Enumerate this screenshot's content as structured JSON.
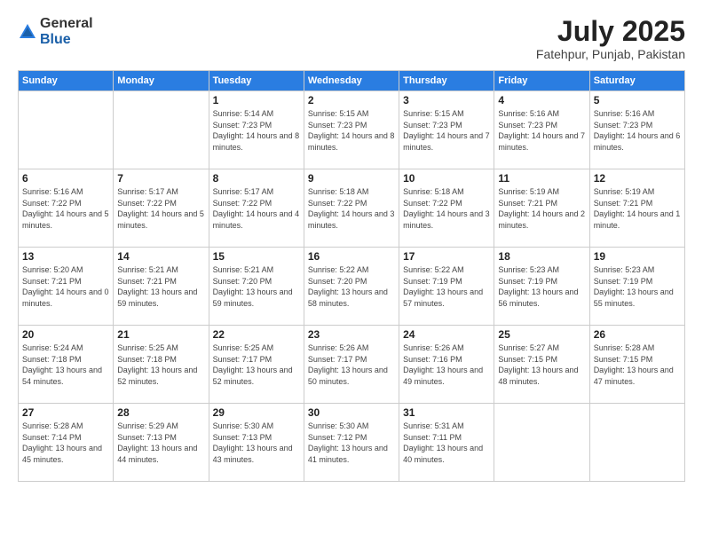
{
  "header": {
    "logo_general": "General",
    "logo_blue": "Blue",
    "month": "July 2025",
    "location": "Fatehpur, Punjab, Pakistan"
  },
  "days_of_week": [
    "Sunday",
    "Monday",
    "Tuesday",
    "Wednesday",
    "Thursday",
    "Friday",
    "Saturday"
  ],
  "weeks": [
    [
      {
        "num": "",
        "info": ""
      },
      {
        "num": "",
        "info": ""
      },
      {
        "num": "1",
        "info": "Sunrise: 5:14 AM\nSunset: 7:23 PM\nDaylight: 14 hours\nand 8 minutes."
      },
      {
        "num": "2",
        "info": "Sunrise: 5:15 AM\nSunset: 7:23 PM\nDaylight: 14 hours\nand 8 minutes."
      },
      {
        "num": "3",
        "info": "Sunrise: 5:15 AM\nSunset: 7:23 PM\nDaylight: 14 hours\nand 7 minutes."
      },
      {
        "num": "4",
        "info": "Sunrise: 5:16 AM\nSunset: 7:23 PM\nDaylight: 14 hours\nand 7 minutes."
      },
      {
        "num": "5",
        "info": "Sunrise: 5:16 AM\nSunset: 7:23 PM\nDaylight: 14 hours\nand 6 minutes."
      }
    ],
    [
      {
        "num": "6",
        "info": "Sunrise: 5:16 AM\nSunset: 7:22 PM\nDaylight: 14 hours\nand 5 minutes."
      },
      {
        "num": "7",
        "info": "Sunrise: 5:17 AM\nSunset: 7:22 PM\nDaylight: 14 hours\nand 5 minutes."
      },
      {
        "num": "8",
        "info": "Sunrise: 5:17 AM\nSunset: 7:22 PM\nDaylight: 14 hours\nand 4 minutes."
      },
      {
        "num": "9",
        "info": "Sunrise: 5:18 AM\nSunset: 7:22 PM\nDaylight: 14 hours\nand 3 minutes."
      },
      {
        "num": "10",
        "info": "Sunrise: 5:18 AM\nSunset: 7:22 PM\nDaylight: 14 hours\nand 3 minutes."
      },
      {
        "num": "11",
        "info": "Sunrise: 5:19 AM\nSunset: 7:21 PM\nDaylight: 14 hours\nand 2 minutes."
      },
      {
        "num": "12",
        "info": "Sunrise: 5:19 AM\nSunset: 7:21 PM\nDaylight: 14 hours\nand 1 minute."
      }
    ],
    [
      {
        "num": "13",
        "info": "Sunrise: 5:20 AM\nSunset: 7:21 PM\nDaylight: 14 hours\nand 0 minutes."
      },
      {
        "num": "14",
        "info": "Sunrise: 5:21 AM\nSunset: 7:21 PM\nDaylight: 13 hours\nand 59 minutes."
      },
      {
        "num": "15",
        "info": "Sunrise: 5:21 AM\nSunset: 7:20 PM\nDaylight: 13 hours\nand 59 minutes."
      },
      {
        "num": "16",
        "info": "Sunrise: 5:22 AM\nSunset: 7:20 PM\nDaylight: 13 hours\nand 58 minutes."
      },
      {
        "num": "17",
        "info": "Sunrise: 5:22 AM\nSunset: 7:19 PM\nDaylight: 13 hours\nand 57 minutes."
      },
      {
        "num": "18",
        "info": "Sunrise: 5:23 AM\nSunset: 7:19 PM\nDaylight: 13 hours\nand 56 minutes."
      },
      {
        "num": "19",
        "info": "Sunrise: 5:23 AM\nSunset: 7:19 PM\nDaylight: 13 hours\nand 55 minutes."
      }
    ],
    [
      {
        "num": "20",
        "info": "Sunrise: 5:24 AM\nSunset: 7:18 PM\nDaylight: 13 hours\nand 54 minutes."
      },
      {
        "num": "21",
        "info": "Sunrise: 5:25 AM\nSunset: 7:18 PM\nDaylight: 13 hours\nand 52 minutes."
      },
      {
        "num": "22",
        "info": "Sunrise: 5:25 AM\nSunset: 7:17 PM\nDaylight: 13 hours\nand 52 minutes."
      },
      {
        "num": "23",
        "info": "Sunrise: 5:26 AM\nSunset: 7:17 PM\nDaylight: 13 hours\nand 50 minutes."
      },
      {
        "num": "24",
        "info": "Sunrise: 5:26 AM\nSunset: 7:16 PM\nDaylight: 13 hours\nand 49 minutes."
      },
      {
        "num": "25",
        "info": "Sunrise: 5:27 AM\nSunset: 7:15 PM\nDaylight: 13 hours\nand 48 minutes."
      },
      {
        "num": "26",
        "info": "Sunrise: 5:28 AM\nSunset: 7:15 PM\nDaylight: 13 hours\nand 47 minutes."
      }
    ],
    [
      {
        "num": "27",
        "info": "Sunrise: 5:28 AM\nSunset: 7:14 PM\nDaylight: 13 hours\nand 45 minutes."
      },
      {
        "num": "28",
        "info": "Sunrise: 5:29 AM\nSunset: 7:13 PM\nDaylight: 13 hours\nand 44 minutes."
      },
      {
        "num": "29",
        "info": "Sunrise: 5:30 AM\nSunset: 7:13 PM\nDaylight: 13 hours\nand 43 minutes."
      },
      {
        "num": "30",
        "info": "Sunrise: 5:30 AM\nSunset: 7:12 PM\nDaylight: 13 hours\nand 41 minutes."
      },
      {
        "num": "31",
        "info": "Sunrise: 5:31 AM\nSunset: 7:11 PM\nDaylight: 13 hours\nand 40 minutes."
      },
      {
        "num": "",
        "info": ""
      },
      {
        "num": "",
        "info": ""
      }
    ]
  ]
}
